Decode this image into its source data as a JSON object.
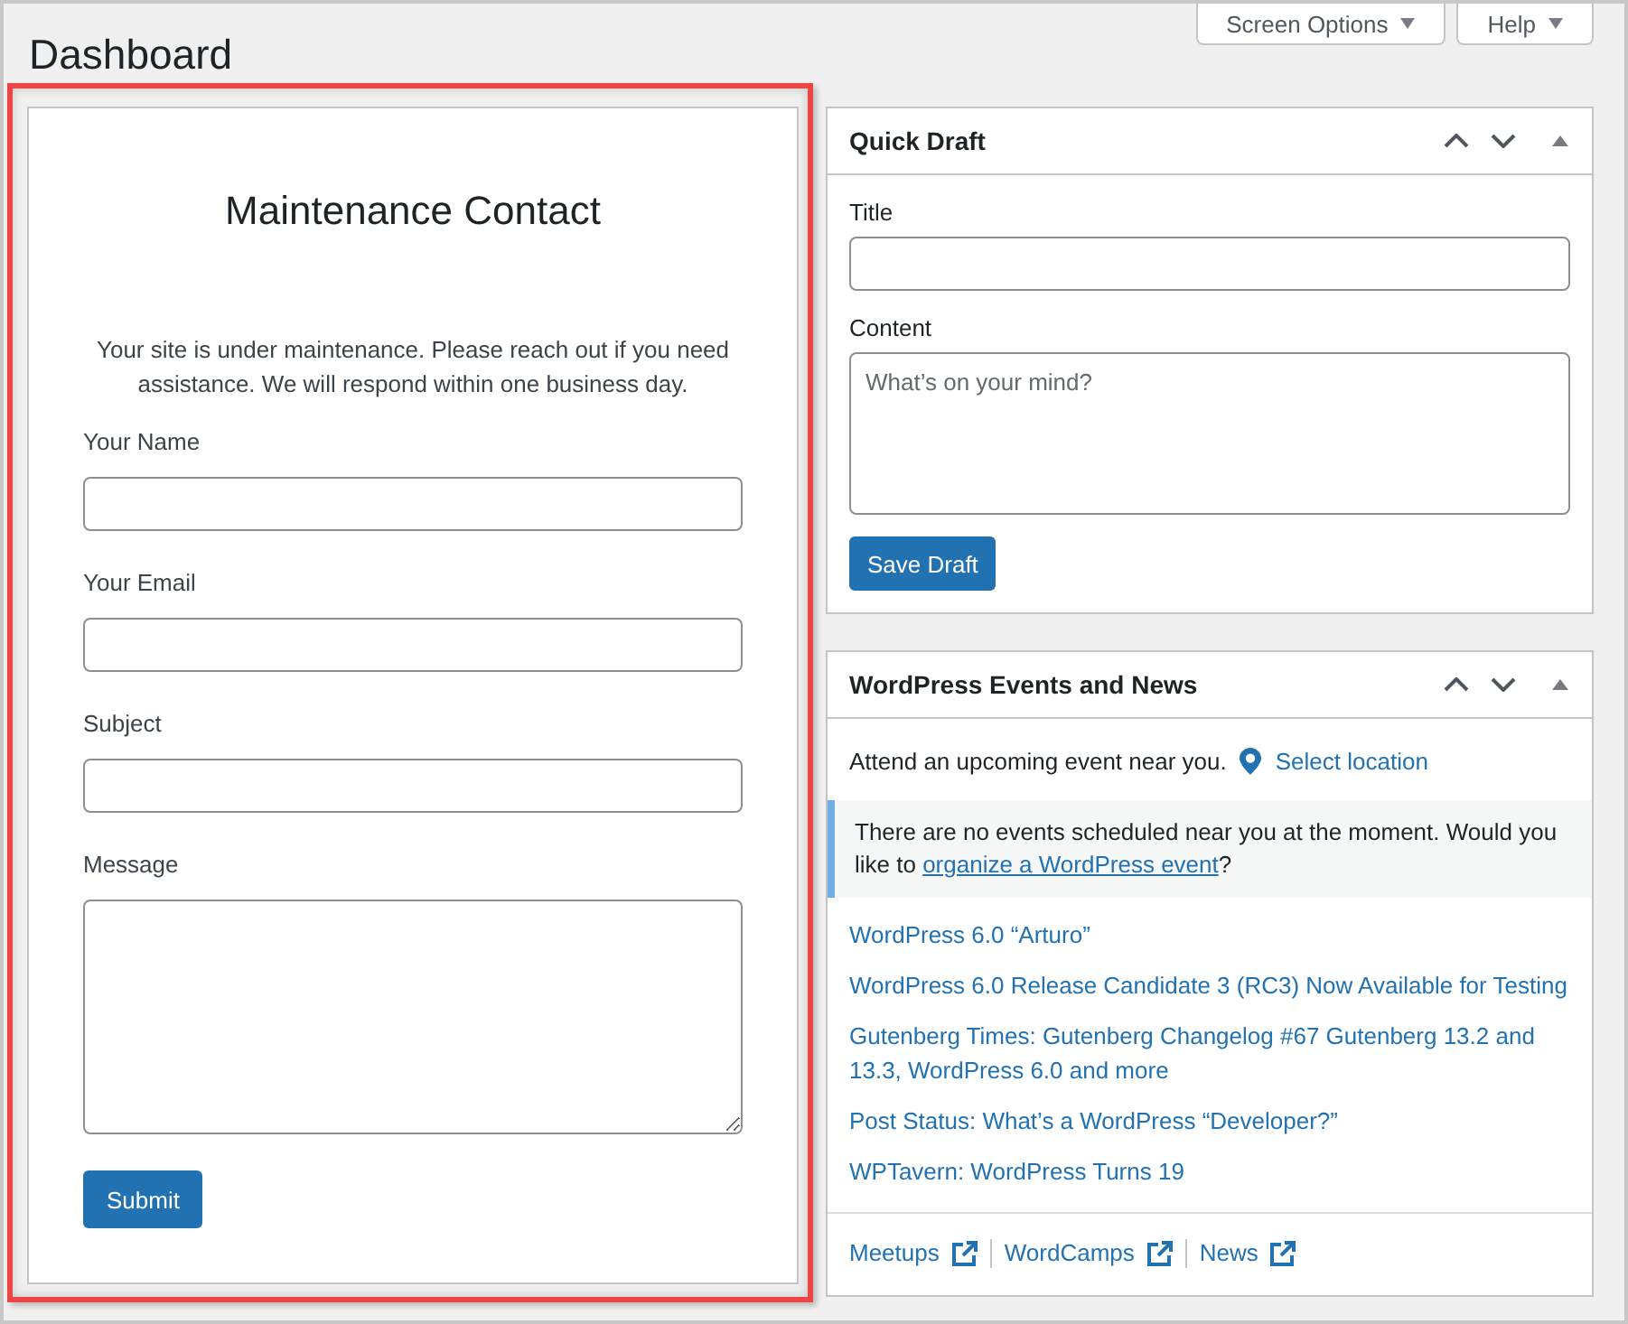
{
  "header": {
    "title": "Dashboard",
    "buttons": [
      {
        "label": "Screen Options"
      },
      {
        "label": "Help"
      }
    ]
  },
  "contact_widget": {
    "highlighted": true,
    "title": "Maintenance Contact",
    "intro": "Your site is under maintenance. Please reach out if you need assistance. We will respond within one business day.",
    "fields": [
      {
        "label": "Your Name",
        "kind": "text"
      },
      {
        "label": "Your Email",
        "kind": "text"
      },
      {
        "label": "Subject",
        "kind": "text"
      },
      {
        "label": "Message",
        "kind": "textarea"
      }
    ],
    "submit": "Submit"
  },
  "quick_draft": {
    "title": "Quick Draft",
    "expanded": true,
    "fields": [
      {
        "label": "Title",
        "kind": "text"
      },
      {
        "label": "Content",
        "kind": "textarea",
        "placeholder": "What’s on your mind?"
      }
    ],
    "button": "Save Draft"
  },
  "events_news": {
    "title": "WordPress Events and News",
    "expanded": true,
    "intro": "Attend an upcoming event near you.",
    "location_link": "Select location",
    "notice": {
      "text": "There are no events scheduled near you at the moment. Would you like to",
      "link": "organize a WordPress event",
      "end": "?"
    },
    "news": [
      "WordPress 6.0 “Arturo”",
      "WordPress 6.0 Release Candidate 3 (RC3) Now Available for Testing",
      "Gutenberg Times: Gutenberg Changelog #67 Gutenberg 13.2 and 13.3, WordPress 6.0 and more",
      "Post Status: What’s a WordPress “Developer?”",
      "WPTavern: WordPress Turns 19"
    ],
    "footer_links": [
      "Meetups",
      "WordCamps",
      "News"
    ]
  }
}
